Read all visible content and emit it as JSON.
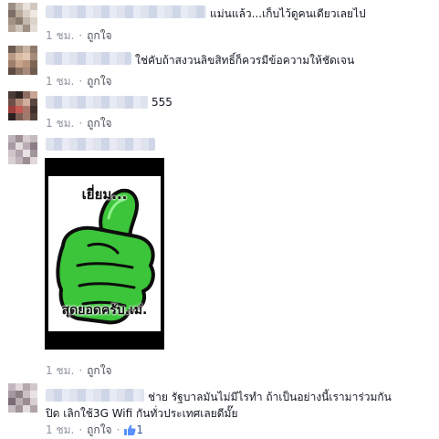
{
  "comments": [
    {
      "text": "แม่นแล้ว...เก็บไว้ดูคนเดียวเลยไป",
      "time": "1 ชม.",
      "like_label": "ถูกใจ",
      "avatar": "blurred-profile-photo"
    },
    {
      "text": "ใช่คับถ้าสงวนลิขสิทธิ์ก็ควรมีข้อความให้ชัดเจน",
      "time": "1 ชม.",
      "like_label": "ถูกใจ",
      "avatar": "blurred-profile-photo"
    },
    {
      "text": "555",
      "time": "1 ชม.",
      "like_label": "ถูกใจ",
      "avatar": "blurred-profile-photo"
    },
    {
      "text": "",
      "time": "1 ชม.",
      "like_label": "ถูกใจ",
      "avatar": "blurred-profile-photo",
      "image": {
        "caption_top": "เยี่ยม...",
        "caption_bottom": "สุดยอดครับ.เม่.",
        "icon": "green-thumbs-up-icon"
      }
    },
    {
      "text_line1": "ช่าย รัฐบาลมันไม่มีไรทำ ถ้าเป็นอย่างนี้เรามาร่วมกัน",
      "text_line2": "ปิด เลิกใช้3G Wifi กันทั่วประเทศเลยดีมั๊ย",
      "time": "1 ชม.",
      "like_label": "ถูกใจ",
      "like_count": "1",
      "avatar": "blurred-profile-photo"
    }
  ],
  "separator": "·",
  "colors": {
    "link": "#365899",
    "meta": "#90949c",
    "text": "#141823"
  }
}
